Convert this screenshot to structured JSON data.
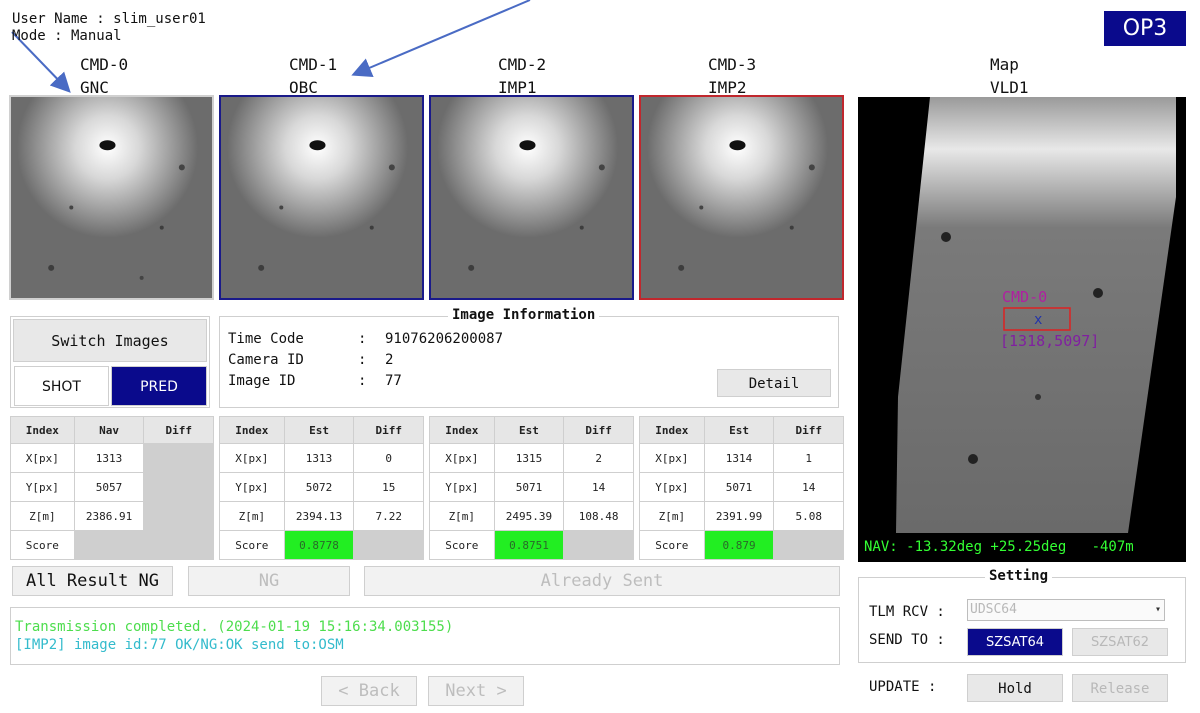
{
  "header": {
    "user_line": "User Name : slim_user01",
    "mode_line": "Mode : Manual",
    "op_badge": "OP3"
  },
  "cameras": [
    {
      "cmd": "CMD-0",
      "source": "GNC",
      "frame": "gray"
    },
    {
      "cmd": "CMD-1",
      "source": "OBC",
      "frame": "blue"
    },
    {
      "cmd": "CMD-2",
      "source": "IMP1",
      "frame": "blue"
    },
    {
      "cmd": "CMD-3",
      "source": "IMP2",
      "frame": "red"
    }
  ],
  "map": {
    "title": "Map",
    "source": "VLD1",
    "marker_label": "CMD-0",
    "marker_coords": "[1318,5097]",
    "nav_readout": "NAV: -13.32deg +25.25deg   -407m"
  },
  "switch_panel": {
    "switch_label": "Switch Images",
    "shot_label": "SHOT",
    "pred_label": "PRED",
    "selected": "PRED"
  },
  "image_info": {
    "title": "Image Information",
    "rows": [
      {
        "label": "Time Code",
        "value": "91076206200087"
      },
      {
        "label": "Camera ID",
        "value": "2"
      },
      {
        "label": "Image ID",
        "value": "77"
      }
    ],
    "detail_label": "Detail"
  },
  "tables": [
    {
      "headers": [
        "Index",
        "Nav",
        "Diff"
      ],
      "rows": [
        [
          "X[px]",
          "1313",
          ""
        ],
        [
          "Y[px]",
          "5057",
          ""
        ],
        [
          "Z[m]",
          "2386.91",
          ""
        ],
        [
          "Score",
          "",
          ""
        ]
      ]
    },
    {
      "headers": [
        "Index",
        "Est",
        "Diff"
      ],
      "rows": [
        [
          "X[px]",
          "1313",
          "0"
        ],
        [
          "Y[px]",
          "5072",
          "15"
        ],
        [
          "Z[m]",
          "2394.13",
          "7.22"
        ],
        [
          "Score",
          "0.8778",
          ""
        ]
      ]
    },
    {
      "headers": [
        "Index",
        "Est",
        "Diff"
      ],
      "rows": [
        [
          "X[px]",
          "1315",
          "2"
        ],
        [
          "Y[px]",
          "5071",
          "14"
        ],
        [
          "Z[m]",
          "2495.39",
          "108.48"
        ],
        [
          "Score",
          "0.8751",
          ""
        ]
      ]
    },
    {
      "headers": [
        "Index",
        "Est",
        "Diff"
      ],
      "rows": [
        [
          "X[px]",
          "1314",
          "1"
        ],
        [
          "Y[px]",
          "5071",
          "14"
        ],
        [
          "Z[m]",
          "2391.99",
          "5.08"
        ],
        [
          "Score",
          "0.879",
          ""
        ]
      ]
    }
  ],
  "actions": {
    "all_result": "All Result NG",
    "ng": "NG",
    "already_sent": "Already Sent"
  },
  "log": [
    "Transmission completed. (2024-01-19 15:16:34.003155)",
    "[IMP2] image id:77 OK/NG:OK send to:OSM"
  ],
  "nav_buttons": {
    "back": "< Back",
    "next": "Next >"
  },
  "setting": {
    "title": "Setting",
    "tlm_label": "TLM RCV :",
    "tlm_value": "UDSC64",
    "send_label": "SEND TO :",
    "send_primary": "SZSAT64",
    "send_secondary": "SZSAT62",
    "update_label": "UPDATE :",
    "hold_label": "Hold",
    "release_label": "Release"
  },
  "colors": {
    "accent_blue": "#0a0a8c",
    "score_green": "#22ee22",
    "log_green": "#4ddd4d",
    "log_cyan": "#33bbcc",
    "frame_red": "#c0272d"
  }
}
